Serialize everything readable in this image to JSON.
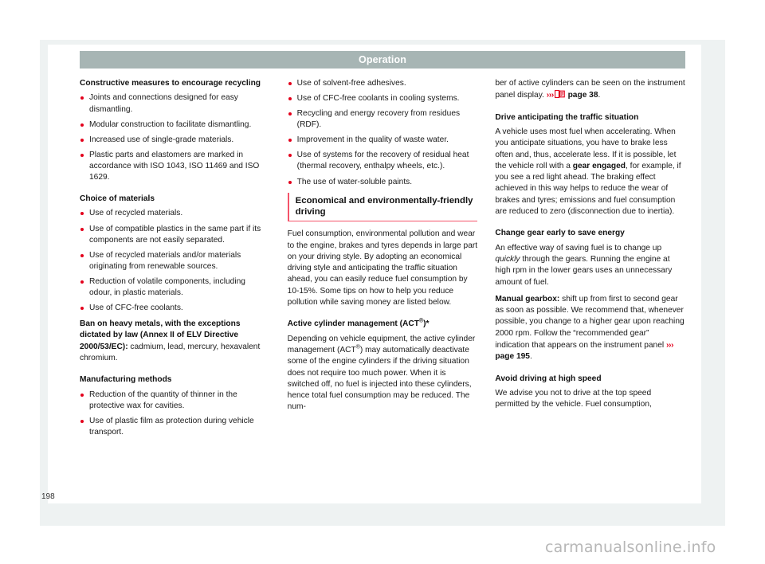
{
  "header": {
    "title": "Operation",
    "bar_color": "#a7b5b4"
  },
  "page_number": "198",
  "watermark": "carmanualsonline.info",
  "accent": {
    "bullet_red": "#e3001b",
    "heading_rule": "#f4536a"
  },
  "column_left": {
    "heading_1": "Constructive measures to encourage recycling",
    "bullets_1": [
      "Joints and connections designed for easy dismantling.",
      "Modular construction to facilitate dismantling.",
      "Increased use of single-grade materials.",
      "Plastic parts and elastomers are marked in accordance with ISO 1043, ISO 11469 and ISO 1629."
    ],
    "heading_2": "Choice of materials",
    "bullets_2": [
      "Use of recycled materials.",
      "Use of compatible plastics in the same part if its components are not easily separated.",
      "Use of recycled materials and/or materials originating from renewable sources.",
      "Reduction of volatile components, including odour, in plastic materials.",
      "Use of CFC-free coolants."
    ],
    "heavy_metals_bold": "Ban on heavy metals, with the exceptions dictated by law (Annex II of ELV Directive 2000/53/EC):",
    "heavy_metals_rest": " cadmium, lead, mercury, hexavalent chromium.",
    "heading_3": "Manufacturing methods",
    "bullets_3": [
      "Reduction of the quantity of thinner in the protective wax for cavities.",
      "Use of plastic film as protection during vehicle transport."
    ]
  },
  "column_middle": {
    "bullets_1": [
      "Use of solvent-free adhesives.",
      "Use of CFC-free coolants in cooling systems.",
      "Recycling and energy recovery from residues (RDF).",
      "Improvement in the quality of waste water.",
      "Use of systems for the recovery of residual heat (thermal recovery, enthalpy wheels, etc.).",
      "The use of water-soluble paints."
    ],
    "section_heading": "Economical and environmentally-friendly driving",
    "intro_paragraph": "Fuel consumption, environmental pollution and wear to the engine, brakes and tyres depends in large part on your driving style. By adopting an economical driving style and anticipating the traffic situation ahead, you can easily reduce fuel consumption by 10-15%. Some tips on how to help you reduce pollution while saving money are listed below.",
    "act_heading_pre": "Active cylinder management (ACT",
    "act_heading_sup": "®",
    "act_heading_post": ")*",
    "act_para_1": "Depending on vehicle equipment, the active cylinder management (ACT",
    "act_para_sup": "®",
    "act_para_2": ") may automatically deactivate some of the engine cylinders if the driving situation does not require too much power. When it is switched off, no fuel is injected into these cylinders, hence total fuel consumption may be reduced. The num-"
  },
  "column_right": {
    "continuation_pre": "ber of active cylinders can be seen on the instrument panel display.",
    "ref_arrow": "›››",
    "ref_icon": "book-icon",
    "ref_page": "page 38",
    "ref_period": ".",
    "heading_1": "Drive anticipating the traffic situation",
    "para_1_a": "A vehicle uses most fuel when accelerating. When you anticipate situations, you have to brake less often and, thus, accelerate less. If it is possible, let the vehicle roll with a ",
    "para_1_bold": "gear engaged",
    "para_1_b": ", for example, if you see a red light ahead. The braking effect achieved in this way helps to reduce the wear of brakes and tyres; emissions and fuel consumption are reduced to zero (disconnection due to inertia).",
    "heading_2": "Change gear early to save energy",
    "para_2_a": "An effective way of saving fuel is to change up ",
    "para_2_italic": "quickly",
    "para_2_b": " through the gears. Running the engine at high rpm in the lower gears uses an unnecessary amount of fuel.",
    "manual_bold": "Manual gearbox:",
    "manual_rest": " shift up from first to second gear as soon as possible. We recommend that, whenever possible, you change to a higher gear upon reaching 2000 rpm. Follow the “recommended gear” indication that appears on the instrument panel",
    "manual_ref_arrow": "›››",
    "manual_ref_page": "page 195",
    "manual_ref_period": ".",
    "heading_3": "Avoid driving at high speed",
    "para_3": "We advise you not to drive at the top speed permitted by the vehicle. Fuel consumption,"
  }
}
